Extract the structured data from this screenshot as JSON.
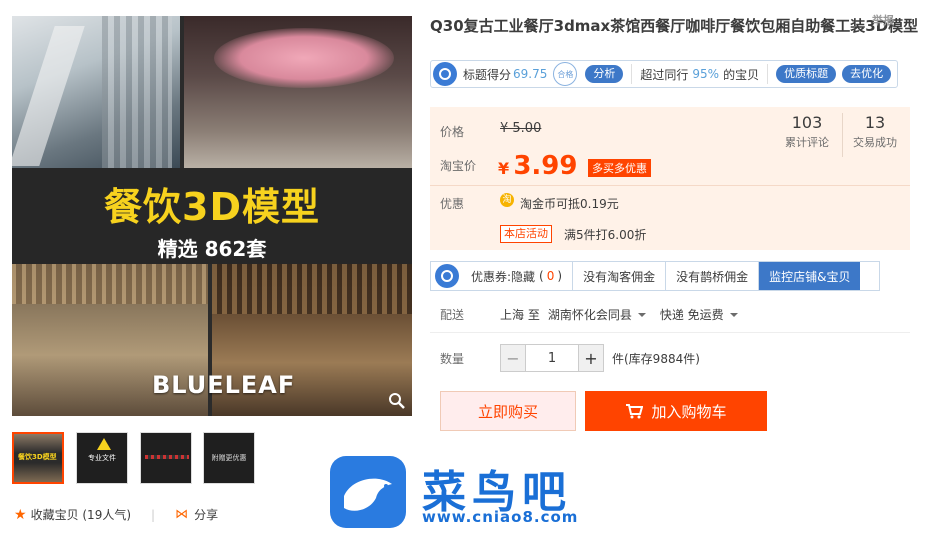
{
  "top_link": "举报",
  "gallery": {
    "banner_title": "餐饮3D模型",
    "banner_subtitle": "精选 862套",
    "brand": "BLUELEAF",
    "thumbs": [
      {
        "text": "餐饮3D模型"
      },
      {
        "text": "专业文件"
      },
      {
        "text": ""
      },
      {
        "text": "附赠更优惠"
      }
    ]
  },
  "favorite": {
    "label": "收藏宝贝 (19人气)",
    "share_label": "分享"
  },
  "product": {
    "title": "Q30复古工业餐厅3dmax茶馆西餐厅咖啡厅餐饮包厢自助餐工装3D模型"
  },
  "score_bar": {
    "score_label": "标题得分",
    "score_value": "69.75",
    "stamp": "合格",
    "analyze": "分析",
    "compare_prefix": "超过同行",
    "compare_pct": "95%",
    "compare_suffix": "的宝贝",
    "quality_title": "优质标题",
    "optimize": "去优化"
  },
  "price": {
    "price_label": "价格",
    "original": "¥ 5.00",
    "taobao_label": "淘宝价",
    "currency": "¥",
    "current": "3.99",
    "promo_tag": "多买多优惠",
    "reviews_count": "103",
    "reviews_label": "累计评论",
    "deals_count": "13",
    "deals_label": "交易成功",
    "discount_label": "优惠",
    "coin_icon": "淘",
    "coin_text": "淘金币可抵0.19元",
    "store_activity": "本店活动",
    "store_activity_text": "满5件打6.00折"
  },
  "coupon_bar": {
    "coupon_label": "优惠券:隐藏",
    "coupon_count": "0",
    "no_taoke": "没有淘客佣金",
    "no_queqiao": "没有鹊桥佣金",
    "monitor": "监控店铺&宝贝"
  },
  "shipping": {
    "label": "配送",
    "from": "上海 至",
    "to": "湖南怀化会同县",
    "method": "快递 免运费"
  },
  "quantity": {
    "label": "数量",
    "minus": "−",
    "value": "1",
    "plus": "+",
    "stock": "件(库存9884件)"
  },
  "actions": {
    "buy_now": "立即购买",
    "add_to_cart": "加入购物车"
  },
  "watermark": {
    "text": "菜鸟吧",
    "url": "www.cniao8.com"
  },
  "colors": {
    "accent": "#ff4400",
    "price_bg": "#fff2e8",
    "tool_blue": "#3d78c8",
    "banner_yellow": "#f7d21e"
  }
}
